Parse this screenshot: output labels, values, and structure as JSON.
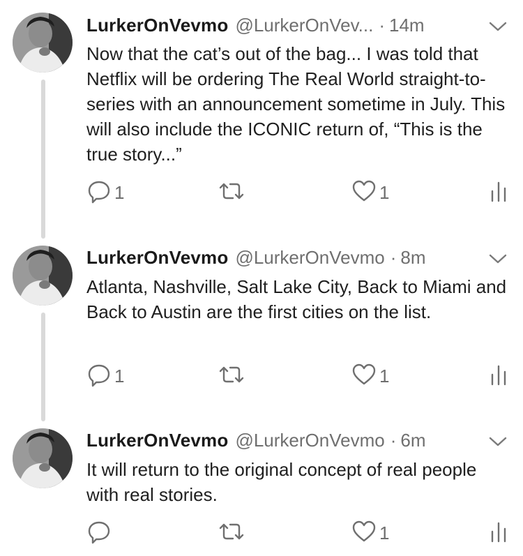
{
  "tweets": [
    {
      "name": "LurkerOnVevmo",
      "handle": "@LurkerOnVev...",
      "separator": "·",
      "time": "14m",
      "text": "Now that the cat’s out of the bag... I was told that Netflix will be ordering The Real World straight-to-series with an announcement sometime in July. This will also include the ICONIC return of, “This is the true story...”",
      "replies": "1",
      "retweets": "",
      "likes": "1"
    },
    {
      "name": "LurkerOnVevmo",
      "handle": "@LurkerOnVevmo",
      "separator": "·",
      "time": "8m",
      "text": "Atlanta, Nashville, Salt Lake City, Back to Miami and Back to Austin are the first cities on the list.",
      "replies": "1",
      "retweets": "",
      "likes": "1"
    },
    {
      "name": "LurkerOnVevmo",
      "handle": "@LurkerOnVevmo",
      "separator": "·",
      "time": "6m",
      "text": "It will return to the original concept of real people with real stories.",
      "replies": "",
      "retweets": "",
      "likes": "1"
    }
  ],
  "icons": {
    "reply": "reply-icon",
    "retweet": "retweet-icon",
    "like": "heart-icon",
    "analytics": "analytics-icon",
    "menu": "chevron-down-icon"
  },
  "colors": {
    "text": "#1f1f1f",
    "muted": "#6f6f6f",
    "thread_line": "#d9d9d9"
  }
}
